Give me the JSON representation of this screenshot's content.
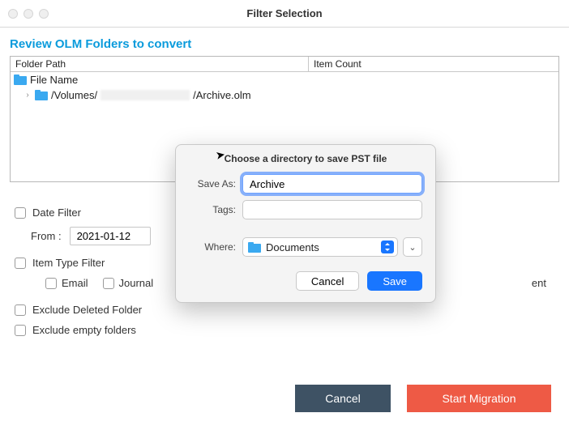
{
  "window": {
    "title": "Filter Selection"
  },
  "heading": "Review OLM Folders to convert",
  "table": {
    "headers": {
      "path": "Folder Path",
      "count": "Item Count"
    },
    "root_label": "File Name",
    "row_prefix": "/Volumes/",
    "row_suffix": "/Archive.olm"
  },
  "filters": {
    "date_filter_label": "Date Filter",
    "from_label": "From :",
    "from_value": "2021-01-12",
    "item_type_label": "Item Type Filter",
    "types": {
      "email": "Email",
      "journal": "Journal"
    },
    "trailing_fragment": "ent",
    "exclude_deleted": "Exclude Deleted Folder",
    "exclude_empty": "Exclude empty folders"
  },
  "footer": {
    "cancel": "Cancel",
    "start": "Start Migration"
  },
  "modal": {
    "title": "Choose a directory to save PST file",
    "save_as_label": "Save As:",
    "save_as_value": "Archive",
    "tags_label": "Tags:",
    "tags_value": "",
    "where_label": "Where:",
    "where_value": "Documents",
    "cancel": "Cancel",
    "save": "Save"
  }
}
